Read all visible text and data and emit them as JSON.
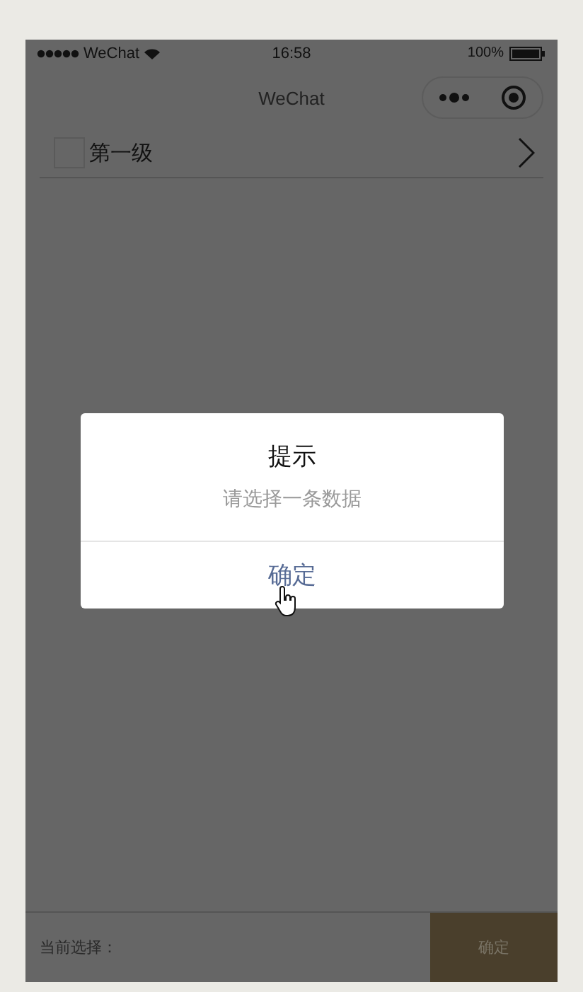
{
  "status_bar": {
    "carrier": "WeChat",
    "time": "16:58",
    "battery": "100%"
  },
  "nav_bar": {
    "title": "WeChat"
  },
  "list": [
    {
      "label": "第一级",
      "checked": false
    }
  ],
  "dialog": {
    "title": "提示",
    "message": "请选择一条数据",
    "button": "确定"
  },
  "footer": {
    "label": "当前选择：",
    "button": "确定"
  }
}
